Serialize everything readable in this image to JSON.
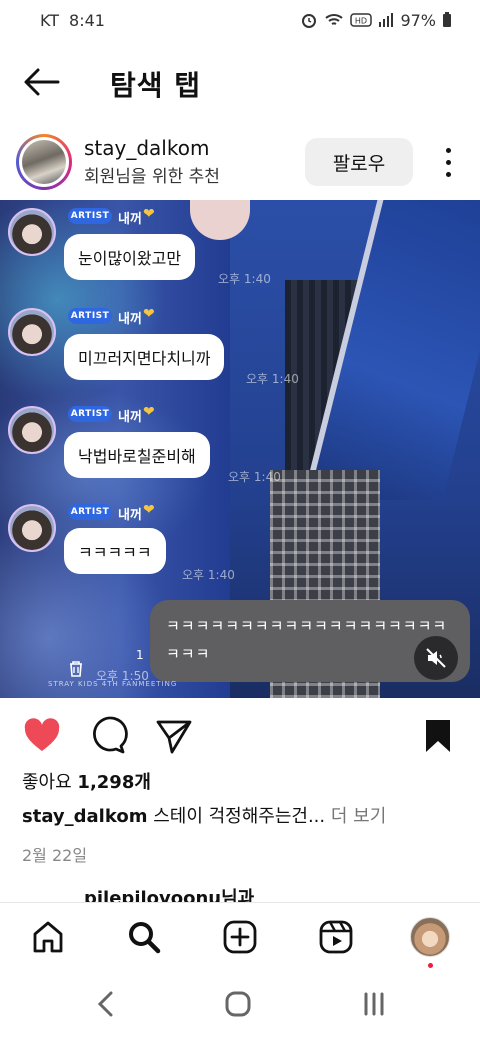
{
  "status_bar": {
    "carrier": "KT",
    "time": "8:41",
    "battery": "97%"
  },
  "header": {
    "title": "탐색 탭"
  },
  "post": {
    "username": "stay_dalkom",
    "subtitle": "회원님을 위한 추천",
    "follow_label": "팔로우"
  },
  "media": {
    "messages": [
      {
        "badge": "ARTIST",
        "sender": "내꺼",
        "text": "눈이많이왔고만",
        "time": "오후 1:40"
      },
      {
        "badge": "ARTIST",
        "sender": "내꺼",
        "text": "미끄러지면다치니까",
        "time": "오후 1:40"
      },
      {
        "badge": "ARTIST",
        "sender": "내꺼",
        "text": "낙법바로칠준비해",
        "time": "오후 1:40"
      },
      {
        "badge": "ARTIST",
        "sender": "내꺼",
        "text": "ㅋㅋㅋㅋㅋ",
        "time": "오후 1:40"
      }
    ],
    "reply": {
      "line1": "ㅋㅋㅋㅋㅋㅋㅋㅋㅋㅋㅋㅋㅋㅋㅋㅋㅋㅋㅋ",
      "line2": "ㅋㅋㅋ",
      "count": "1",
      "time": "오후 1:50"
    },
    "banner": "STRAY KIDS 4TH FANMEETING"
  },
  "engagement": {
    "likes_label": "좋아요",
    "likes_count": "1,298개",
    "caption_user": "stay_dalkom",
    "caption_text": "스테이 걱정해주는건...",
    "more_label": "더 보기",
    "date": "2월 22일",
    "comment_peek": "pilepilovoonu님과"
  },
  "colors": {
    "like": "#ed4956",
    "badge": "#2f67e0",
    "follow_bg": "#efefef"
  },
  "icons": {
    "tabs": [
      "home-icon",
      "search-icon",
      "create-icon",
      "reels-icon",
      "profile-avatar"
    ],
    "nav": [
      "back-nav-icon",
      "home-nav-icon",
      "recents-nav-icon"
    ]
  }
}
